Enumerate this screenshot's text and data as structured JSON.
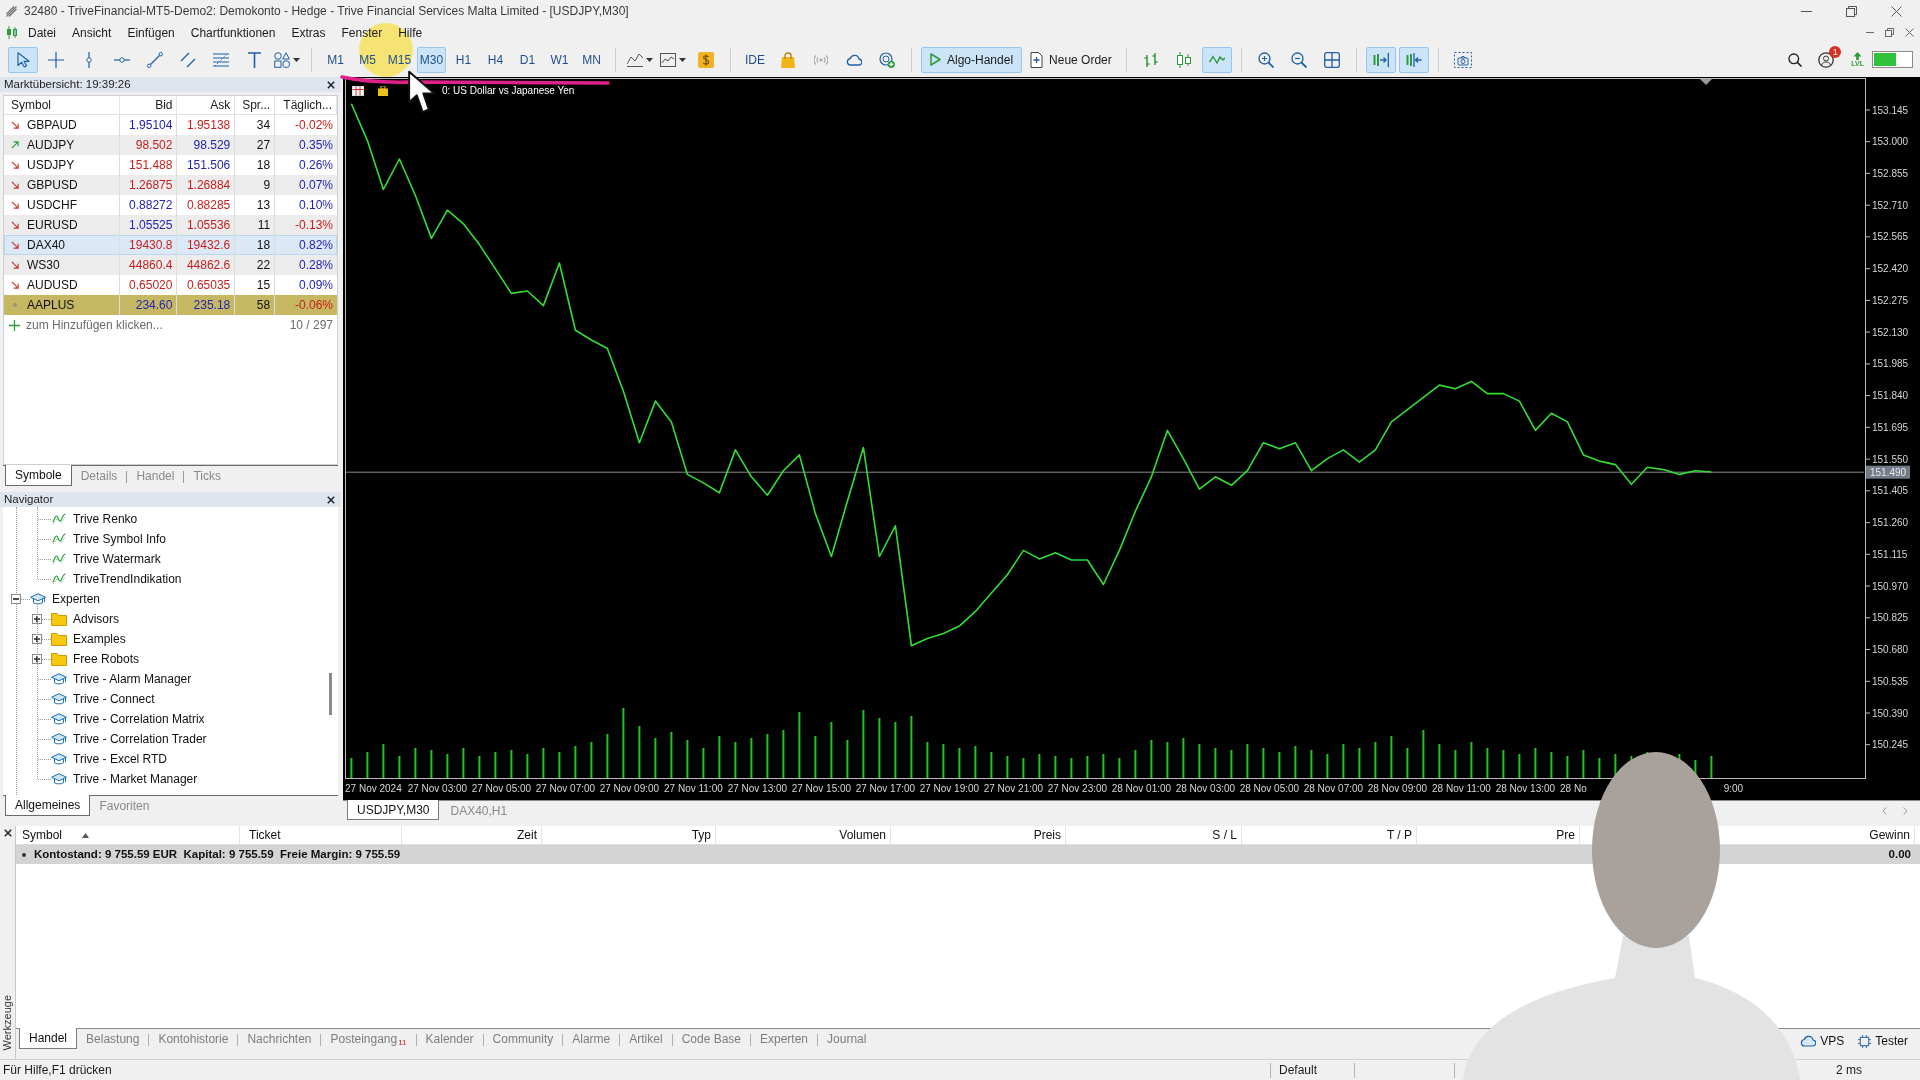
{
  "window": {
    "title": "32480 - TriveFinancial-MT5-Demo2: Demokonto - Hedge - Trive Financial Services Malta Limited - [USDJPY,M30]"
  },
  "menu": [
    "Datei",
    "Ansicht",
    "Einfügen",
    "Chartfunktionen",
    "Extras",
    "Fenster",
    "Hilfe"
  ],
  "toolbar": {
    "drawing_tools": [
      {
        "selected": true
      },
      {
        "selected": false
      },
      {
        "selected": false
      },
      {
        "selected": false
      },
      {
        "selected": false
      },
      {
        "selected": false
      },
      {
        "selected": false
      },
      {
        "selected": false
      },
      {
        "selected": false
      }
    ],
    "timeframes": [
      {
        "label": "M1",
        "selected": false
      },
      {
        "label": "M5",
        "selected": false
      },
      {
        "label": "M15",
        "selected": false
      },
      {
        "label": "M30",
        "selected": true
      },
      {
        "label": "H1",
        "selected": false
      },
      {
        "label": "H4",
        "selected": false
      },
      {
        "label": "D1",
        "selected": false
      },
      {
        "label": "W1",
        "selected": false
      },
      {
        "label": "MN",
        "selected": false
      }
    ],
    "ide": "IDE",
    "algo_trading": {
      "label": "Algo-Handel",
      "on": true
    },
    "new_order": "Neue Order",
    "chart_types": [
      {
        "selected": false
      },
      {
        "selected": false
      },
      {
        "selected": true
      }
    ],
    "chart_toggles": [
      {
        "selected": true
      },
      {
        "selected": true
      }
    ],
    "notifications": "1",
    "level_badge": "LVL"
  },
  "market_watch": {
    "title": "Marktübersicht: 19:39:26",
    "columns": [
      "Symbol",
      "Bid",
      "Ask",
      "Spr...",
      "Täglich..."
    ],
    "rows": [
      {
        "symbol": "GBPAUD",
        "rising": false,
        "falling": true,
        "bid": "1.95104",
        "bid_up": true,
        "ask": "1.95138",
        "ask_up": false,
        "spread": "34",
        "daily": "-0.02%",
        "daily_negative": true,
        "hovered": false,
        "selected": false
      },
      {
        "symbol": "AUDJPY",
        "rising": true,
        "falling": false,
        "bid": "98.502",
        "bid_up": false,
        "ask": "98.529",
        "ask_up": true,
        "spread": "27",
        "daily": "0.35%",
        "daily_negative": false,
        "hovered": false,
        "selected": false
      },
      {
        "symbol": "USDJPY",
        "rising": false,
        "falling": true,
        "bid": "151.488",
        "bid_up": false,
        "ask": "151.506",
        "ask_up": true,
        "spread": "18",
        "daily": "0.26%",
        "daily_negative": false,
        "hovered": false,
        "selected": false
      },
      {
        "symbol": "GBPUSD",
        "rising": false,
        "falling": true,
        "bid": "1.26875",
        "bid_up": false,
        "ask": "1.26884",
        "ask_up": false,
        "spread": "9",
        "daily": "0.07%",
        "daily_negative": false,
        "hovered": false,
        "selected": false
      },
      {
        "symbol": "USDCHF",
        "rising": false,
        "falling": true,
        "bid": "0.88272",
        "bid_up": true,
        "ask": "0.88285",
        "ask_up": false,
        "spread": "13",
        "daily": "0.10%",
        "daily_negative": false,
        "hovered": false,
        "selected": false
      },
      {
        "symbol": "EURUSD",
        "rising": false,
        "falling": true,
        "bid": "1.05525",
        "bid_up": true,
        "ask": "1.05536",
        "ask_up": false,
        "spread": "11",
        "daily": "-0.13%",
        "daily_negative": true,
        "hovered": false,
        "selected": false
      },
      {
        "symbol": "DAX40",
        "rising": false,
        "falling": true,
        "bid": "19430.8",
        "bid_up": false,
        "ask": "19432.6",
        "ask_up": false,
        "spread": "18",
        "daily": "0.82%",
        "daily_negative": false,
        "hovered": true,
        "selected": false
      },
      {
        "symbol": "WS30",
        "rising": false,
        "falling": true,
        "bid": "44860.4",
        "bid_up": false,
        "ask": "44862.6",
        "ask_up": false,
        "spread": "22",
        "daily": "0.28%",
        "daily_negative": false,
        "hovered": false,
        "selected": false
      },
      {
        "symbol": "AUDUSD",
        "rising": false,
        "falling": true,
        "bid": "0.65020",
        "bid_up": false,
        "ask": "0.65035",
        "ask_up": false,
        "spread": "15",
        "daily": "0.09%",
        "daily_negative": false,
        "hovered": false,
        "selected": false
      },
      {
        "symbol": "AAPLUS",
        "rising": false,
        "falling": false,
        "bid": "234.60",
        "bid_up": true,
        "ask": "235.18",
        "ask_up": true,
        "spread": "58",
        "daily": "-0.06%",
        "daily_negative": true,
        "hovered": false,
        "selected": true
      }
    ],
    "add_hint": "zum Hinzufügen klicken...",
    "count": "10 / 297",
    "tabs": [
      {
        "label": "Symbole",
        "selected": true
      },
      {
        "label": "Details",
        "selected": false
      },
      {
        "label": "Handel",
        "selected": false
      },
      {
        "label": "Ticks",
        "selected": false
      }
    ]
  },
  "navigator": {
    "title": "Navigator",
    "tree": [
      {
        "children": [
          {
            "label": "Trive Renko",
            "kind": "indicator"
          },
          {
            "label": "Trive Symbol Info",
            "kind": "indicator"
          },
          {
            "label": "Trive Watermark",
            "kind": "indicator"
          },
          {
            "label": "TriveTrendIndikation",
            "kind": "indicator"
          }
        ]
      },
      {
        "label": "Experten",
        "kind": "expert",
        "expanded": true,
        "children": [
          {
            "label": "Advisors",
            "kind": "folder",
            "expanded": false
          },
          {
            "label": "Examples",
            "kind": "folder",
            "expanded": false
          },
          {
            "label": "Free Robots",
            "kind": "folder",
            "expanded": false
          },
          {
            "label": "Trive - Alarm Manager",
            "kind": "expert"
          },
          {
            "label": "Trive - Connect",
            "kind": "expert"
          },
          {
            "label": "Trive - Correlation Matrix",
            "kind": "expert"
          },
          {
            "label": "Trive - Correlation Trader",
            "kind": "expert"
          },
          {
            "label": "Trive - Excel RTD",
            "kind": "expert"
          },
          {
            "label": "Trive - Market Manager",
            "kind": "expert"
          }
        ]
      }
    ],
    "tabs": [
      {
        "label": "Allgemeines",
        "selected": true
      },
      {
        "label": "Favoriten",
        "selected": false
      }
    ]
  },
  "chart": {
    "caption": "0: US Dollar vs Japanese Yen",
    "chart_data": {
      "type": "line",
      "categories": [
        null,
        "27 Nov 2024",
        null,
        null,
        null,
        "27 Nov 03:00",
        null,
        null,
        null,
        "27 Nov 05:00",
        null,
        null,
        null,
        "27 Nov 07:00",
        null,
        null,
        null,
        "27 Nov 09:00",
        null,
        null,
        null,
        "27 Nov 11:00",
        null,
        null,
        null,
        "27 Nov 13:00",
        null,
        null,
        null,
        "27 Nov 15:00",
        null,
        null,
        null,
        "27 Nov 17:00",
        null,
        null,
        null,
        "27 Nov 19:00",
        null,
        null,
        null,
        "27 Nov 21:00",
        null,
        null,
        null,
        "27 Nov 23:00",
        null,
        null,
        null,
        "28 Nov 01:00",
        null,
        null,
        null,
        "28 Nov 03:00",
        null,
        null,
        null,
        "28 Nov 05:00",
        null,
        null,
        null,
        "28 Nov 07:00",
        null,
        null,
        null,
        "28 Nov 09:00",
        null,
        null,
        null,
        "28 Nov 11:00",
        null,
        null,
        null,
        "28 Nov 13:00",
        null,
        null,
        "28 No",
        null,
        null,
        null,
        null,
        null,
        null,
        null,
        null,
        null,
        "9:00"
      ],
      "series": [
        {
          "color": "#33dd33",
          "values": [
            153.173,
            153.005,
            152.782,
            152.921,
            152.754,
            152.558,
            152.687,
            152.625,
            152.53,
            152.419,
            152.307,
            152.318,
            152.251,
            152.446,
            152.139,
            152.094,
            152.055,
            151.86,
            151.625,
            151.815,
            151.72,
            151.48,
            151.441,
            151.396,
            151.592,
            151.469,
            151.385,
            151.497,
            151.569,
            151.301,
            151.105,
            151.357,
            151.603,
            151.105,
            151.245,
            150.697,
            150.731,
            150.753,
            150.787,
            150.854,
            150.938,
            151.022,
            151.133,
            151.094,
            151.122,
            151.089,
            151.089,
            150.977,
            151.133,
            151.312,
            151.469,
            151.681,
            151.552,
            151.413,
            151.469,
            151.43,
            151.497,
            151.625,
            151.597,
            151.625,
            151.497,
            151.552,
            151.592,
            151.536,
            151.592,
            151.72,
            151.776,
            151.832,
            151.888,
            151.871,
            151.905,
            151.849,
            151.849,
            151.815,
            151.681,
            151.759,
            151.72,
            151.569,
            151.541,
            151.525,
            151.435,
            151.513,
            151.502,
            151.48,
            151.497,
            151.491,
            null
          ]
        }
      ],
      "ylim": [
        150.093,
        153.291
      ],
      "yticks": [
        {
          "value": 153.145,
          "label": "153.145"
        },
        {
          "value": 153,
          "label": "153.000"
        },
        {
          "value": 152.855,
          "label": "152.855"
        },
        {
          "value": 152.71,
          "label": "152.710"
        },
        {
          "value": 152.565,
          "label": "152.565"
        },
        {
          "value": 152.42,
          "label": "152.420"
        },
        {
          "value": 152.275,
          "label": "152.275"
        },
        {
          "value": 152.13,
          "label": "152.130"
        },
        {
          "value": 151.985,
          "label": "151.985"
        },
        {
          "value": 151.84,
          "label": "151.840"
        },
        {
          "value": 151.695,
          "label": "151.695"
        },
        {
          "value": 151.55,
          "label": "151.550"
        },
        {
          "value": 151.405,
          "label": "151.405"
        },
        {
          "value": 151.26,
          "label": "151.260"
        },
        {
          "value": 151.115,
          "label": "151.115"
        },
        {
          "value": 150.97,
          "label": "150.970"
        },
        {
          "value": 150.825,
          "label": "150.825"
        },
        {
          "value": 150.68,
          "label": "150.680"
        },
        {
          "value": 150.535,
          "label": "150.535"
        },
        {
          "value": 150.39,
          "label": "150.390"
        },
        {
          "value": 150.245,
          "label": "150.245"
        }
      ],
      "ref_lines": [
        {
          "axis": "y",
          "value": 151.49,
          "label": "151.490"
        }
      ]
    },
    "tabs": [
      {
        "label": "USDJPY,M30",
        "selected": true
      },
      {
        "label": "DAX40,H1",
        "selected": false
      }
    ]
  },
  "toolbox": {
    "side_title": "Werkzeuge",
    "columns": [
      {
        "label": "Symbol",
        "sorted": true
      },
      {
        "label": "Ticket",
        "sorted": false
      },
      {
        "label": "Zeit",
        "sorted": false
      },
      {
        "label": "Typ",
        "sorted": false
      },
      {
        "label": "Volumen",
        "sorted": false
      },
      {
        "label": "Preis",
        "sorted": false
      },
      {
        "label": "S / L",
        "sorted": false
      },
      {
        "label": "T / P",
        "sorted": false
      },
      {
        "label": "Pre",
        "sorted": false
      },
      {
        "label": "Gewinn",
        "sorted": false
      }
    ],
    "summary": {
      "text": "Kontostand: 9 755.59 EUR  Kapital: 9 755.59  Freie Margin: 9 755.59",
      "profit": "0.00"
    },
    "tabs": [
      {
        "label": "Handel",
        "selected": true
      },
      {
        "label": "Belastung",
        "selected": false
      },
      {
        "label": "Kontohistorie",
        "selected": false
      },
      {
        "label": "Nachrichten",
        "selected": false
      },
      {
        "label": "Posteingang",
        "selected": false,
        "badge": "11"
      },
      {
        "label": "Kalender",
        "selected": false
      },
      {
        "label": "Community",
        "selected": false
      },
      {
        "label": "Alarme",
        "selected": false
      },
      {
        "label": "Artikel",
        "selected": false
      },
      {
        "label": "Code Base",
        "selected": false
      },
      {
        "label": "Experten",
        "selected": false
      },
      {
        "label": "Journal",
        "selected": false
      }
    ],
    "services": [
      "VPS",
      "Tester"
    ]
  },
  "status_bar": {
    "help": "Für Hilfe,F1 drücken",
    "profile": "Default",
    "ping": "2 ms"
  }
}
